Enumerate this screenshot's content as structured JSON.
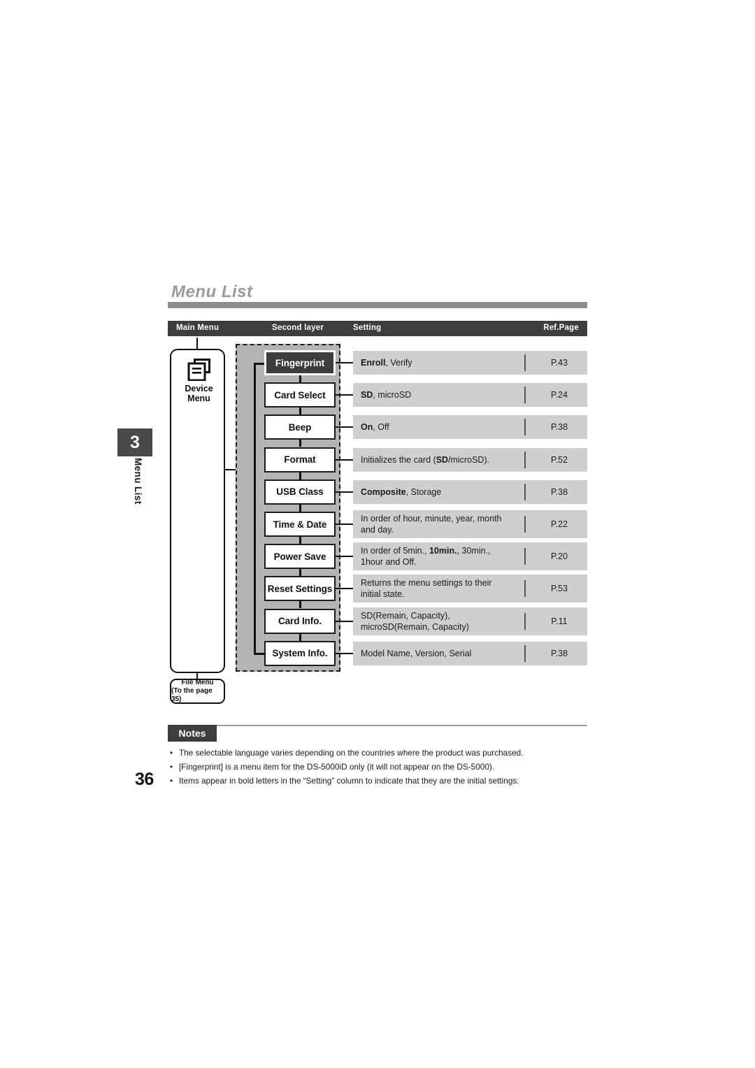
{
  "page": {
    "title": "Menu List",
    "number": "36",
    "chapter_number": "3",
    "chapter_label": "Menu List"
  },
  "table": {
    "headers": {
      "main_menu": "Main Menu",
      "second_layer": "Second layer",
      "setting": "Setting",
      "ref_page": "Ref.Page"
    }
  },
  "main_menu": {
    "icon": "document-list-icon",
    "label_line1": "Device",
    "label_line2": "Menu",
    "file_menu_line1": "File Menu",
    "file_menu_line2": "(To the page 35)"
  },
  "rows": [
    {
      "item": "Fingerprint",
      "highlighted": true,
      "setting_html": "<b>Enroll</b>, Verify",
      "setting_text": "Enroll, Verify",
      "ref": "P.43"
    },
    {
      "item": "Card Select",
      "highlighted": false,
      "setting_html": "<b>SD</b>, microSD",
      "setting_text": "SD, microSD",
      "ref": "P.24"
    },
    {
      "item": "Beep",
      "highlighted": false,
      "setting_html": "<b>On</b>, Off",
      "setting_text": "On, Off",
      "ref": "P.38"
    },
    {
      "item": "Format",
      "highlighted": false,
      "setting_html": "Initializes the card (<b>SD</b>/microSD).",
      "setting_text": "Initializes the card (SD/microSD).",
      "ref": "P.52"
    },
    {
      "item": "USB Class",
      "highlighted": false,
      "setting_html": "<b>Composite</b>, Storage",
      "setting_text": "Composite, Storage",
      "ref": "P.38"
    },
    {
      "item": "Time & Date",
      "highlighted": false,
      "setting_html": "In order of hour, minute, year, month and day.",
      "setting_text": "In order of hour, minute, year, month and day.",
      "ref": "P.22"
    },
    {
      "item": "Power Save",
      "highlighted": false,
      "setting_html": "In order of 5min., <b>10min.</b>, 30min., 1hour and Off.",
      "setting_text": "In order of 5min., 10min., 30min., 1hour and Off.",
      "ref": "P.20"
    },
    {
      "item": "Reset Settings",
      "highlighted": false,
      "setting_html": "Returns the menu settings to their initial state.",
      "setting_text": "Returns the menu settings to their initial state.",
      "ref": "P.53"
    },
    {
      "item": "Card Info.",
      "highlighted": false,
      "setting_html": "SD(Remain, Capacity), microSD(Remain, Capacity)",
      "setting_text": "SD(Remain, Capacity), microSD(Remain, Capacity)",
      "ref": "P.11"
    },
    {
      "item": "System Info.",
      "highlighted": false,
      "setting_html": "Model Name, Version, Serial",
      "setting_text": "Model Name, Version, Serial",
      "ref": "P.38"
    }
  ],
  "notes": {
    "title": "Notes",
    "bullet": "•",
    "items": [
      "The selectable language varies depending on the countries where the product was purchased.",
      "[Fingerprint] is a menu item for the DS-5000iD only (it will not appear on the DS-5000).",
      "Items appear in bold letters in the “Setting” column to indicate that they are the initial settings."
    ]
  },
  "colors": {
    "header_bar": "#3d3d3d",
    "row_bg": "#cfcfcf",
    "group_bg": "#b4b4b4",
    "title_gray": "#9a9a9a",
    "rule_gray": "#8c8c8c"
  }
}
